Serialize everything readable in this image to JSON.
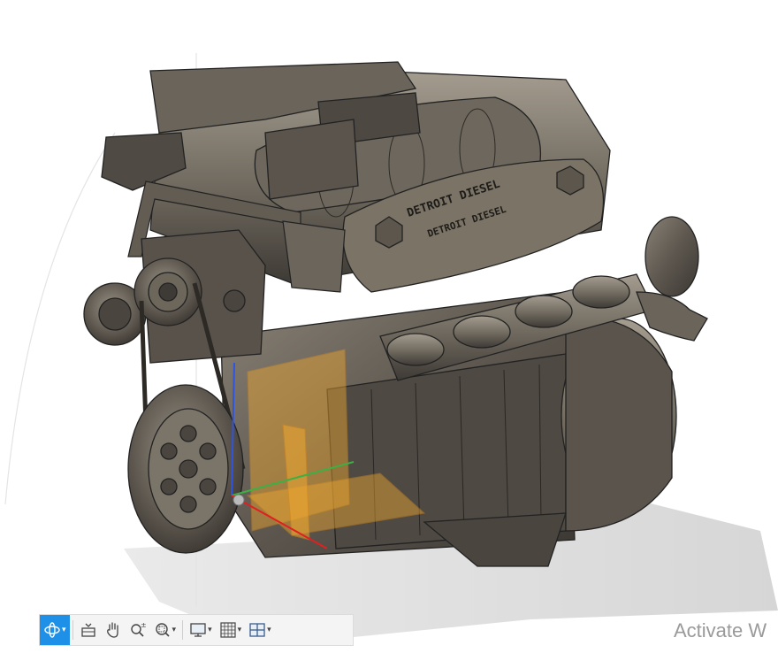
{
  "app": {
    "background_color": "#ffffff"
  },
  "model": {
    "plate_left_text": "DETROIT DIESEL",
    "plate_right_text": "DETROIT DIESEL",
    "body_color": "#5b554d",
    "highlight_color": "#f0a830"
  },
  "nav_toolbar": {
    "buttons": [
      {
        "id": "orbit",
        "icon": "orbit-icon",
        "active": true,
        "has_dropdown": true
      },
      {
        "id": "look_at",
        "icon": "look-at-icon",
        "active": false,
        "has_dropdown": false
      },
      {
        "id": "pan",
        "icon": "pan-hand-icon",
        "active": false,
        "has_dropdown": false
      },
      {
        "id": "zoom",
        "icon": "zoom-icon",
        "active": false,
        "has_dropdown": false
      },
      {
        "id": "fit",
        "icon": "fit-window-icon",
        "active": false,
        "has_dropdown": true
      },
      {
        "id": "display",
        "icon": "display-settings-icon",
        "active": false,
        "has_dropdown": true
      },
      {
        "id": "grid",
        "icon": "grid-snaps-icon",
        "active": false,
        "has_dropdown": true
      },
      {
        "id": "viewports",
        "icon": "viewports-icon",
        "active": false,
        "has_dropdown": true
      }
    ],
    "accent_color": "#1e90e8"
  },
  "watermark": {
    "text": "Activate W"
  }
}
